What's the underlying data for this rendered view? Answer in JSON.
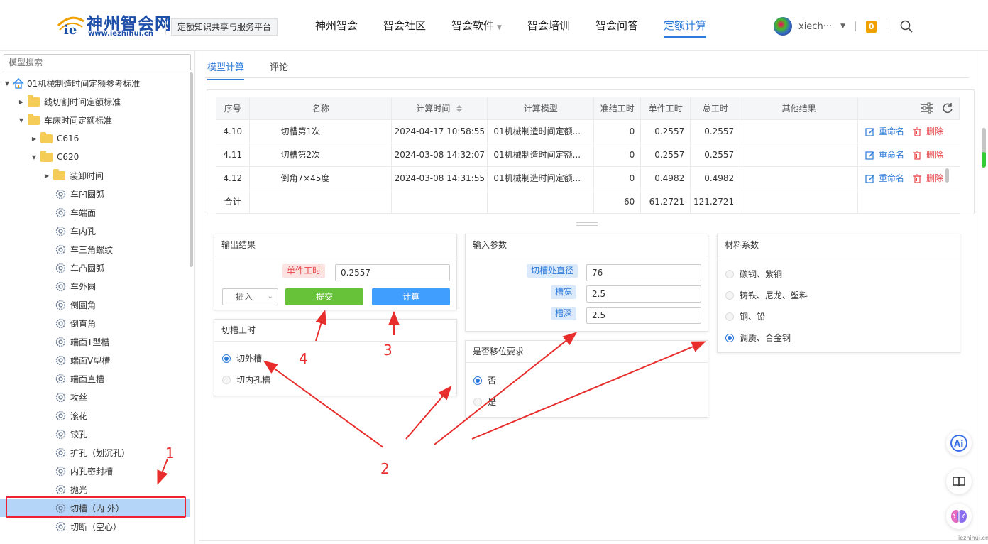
{
  "header": {
    "logo_title": "神州智会网",
    "logo_url": "www.iezhihui.cn",
    "platform_label": "定额知识共享与服务平台",
    "nav": [
      "神州智会",
      "智会社区",
      "智会软件",
      "智会培训",
      "智会问答",
      "定额计算"
    ],
    "active_nav": "定额计算",
    "user_name": "xiech···",
    "badge_count": "0"
  },
  "sidebar": {
    "search_placeholder": "模型搜索",
    "tree": [
      {
        "label": "01机械制造时间定额参考标准",
        "type": "root"
      },
      {
        "label": "线切割时间定额标准",
        "type": "folder"
      },
      {
        "label": "车床时间定额标准",
        "type": "folder"
      },
      {
        "label": "C616",
        "type": "folder"
      },
      {
        "label": "C620",
        "type": "folder"
      },
      {
        "label": "装卸时间",
        "type": "folder"
      },
      {
        "label": "车凹圆弧",
        "type": "model"
      },
      {
        "label": "车端面",
        "type": "model"
      },
      {
        "label": "车内孔",
        "type": "model"
      },
      {
        "label": "车三角螺纹",
        "type": "model"
      },
      {
        "label": "车凸圆弧",
        "type": "model"
      },
      {
        "label": "车外圆",
        "type": "model"
      },
      {
        "label": "倒圆角",
        "type": "model"
      },
      {
        "label": "倒直角",
        "type": "model"
      },
      {
        "label": "端面T型槽",
        "type": "model"
      },
      {
        "label": "端面V型槽",
        "type": "model"
      },
      {
        "label": "端面直槽",
        "type": "model"
      },
      {
        "label": "攻丝",
        "type": "model"
      },
      {
        "label": "滚花",
        "type": "model"
      },
      {
        "label": "铰孔",
        "type": "model"
      },
      {
        "label": "扩孔（划沉孔）",
        "type": "model"
      },
      {
        "label": "内孔密封槽",
        "type": "model"
      },
      {
        "label": "抛光",
        "type": "model"
      },
      {
        "label": "切槽（内 外）",
        "type": "model",
        "selected": true
      },
      {
        "label": "切断（空心）",
        "type": "model"
      }
    ]
  },
  "tabs": [
    "模型计算",
    "评论"
  ],
  "table": {
    "headers": [
      "序号",
      "名称",
      "计算时间",
      "计算模型",
      "准结工时",
      "单件工时",
      "总工时",
      "其他结果"
    ],
    "rows": [
      {
        "no": "4.10",
        "name": "切槽第1次",
        "time": "2024-04-17 10:58:55",
        "model": "01机械制造时间定额...",
        "setup": "0",
        "unit": "0.2557",
        "total": "0.2557"
      },
      {
        "no": "4.11",
        "name": "切槽第2次",
        "time": "2024-03-08 14:32:07",
        "model": "01机械制造时间定额...",
        "setup": "0",
        "unit": "0.2557",
        "total": "0.2557"
      },
      {
        "no": "4.12",
        "name": "倒角7×45度",
        "time": "2024-03-08 14:31:55",
        "model": "01机械制造时间定额...",
        "setup": "0",
        "unit": "0.4982",
        "total": "0.4982"
      }
    ],
    "rename_label": "重命名",
    "delete_label": "删除",
    "sum_label": "合计",
    "sum_setup": "60",
    "sum_unit": "61.2721",
    "sum_total": "121.2721"
  },
  "output_panel": {
    "title": "输出结果",
    "field_label": "单件工时",
    "field_value": "0.2557",
    "insert_label": "插入",
    "submit_label": "提交",
    "calc_label": "计算"
  },
  "groove_panel": {
    "title": "切槽工时",
    "options": [
      "切外槽",
      "切内孔槽"
    ],
    "selected": "切外槽"
  },
  "input_panel": {
    "title": "输入参数",
    "params": [
      {
        "label": "切槽处直径",
        "value": "76"
      },
      {
        "label": "槽宽",
        "value": "2.5"
      },
      {
        "label": "槽深",
        "value": "2.5"
      }
    ]
  },
  "move_panel": {
    "title": "是否移位要求",
    "options": [
      "否",
      "是"
    ],
    "selected": "否"
  },
  "material_panel": {
    "title": "材料系数",
    "options": [
      "碳钢、紫铜",
      "铸铁、尼龙、塑料",
      "铜、铅",
      "调质、合金钢"
    ],
    "selected": "调质、合金钢"
  },
  "annotations": {
    "a1": "1",
    "a2": "2",
    "a3": "3",
    "a4": "4"
  },
  "watermark": "iezhihui.cn",
  "colors": {
    "accent": "#2d7ad9",
    "submit": "#67c23a",
    "calc": "#409eff",
    "danger": "#e8454a",
    "annotation": "#e82d2d"
  }
}
